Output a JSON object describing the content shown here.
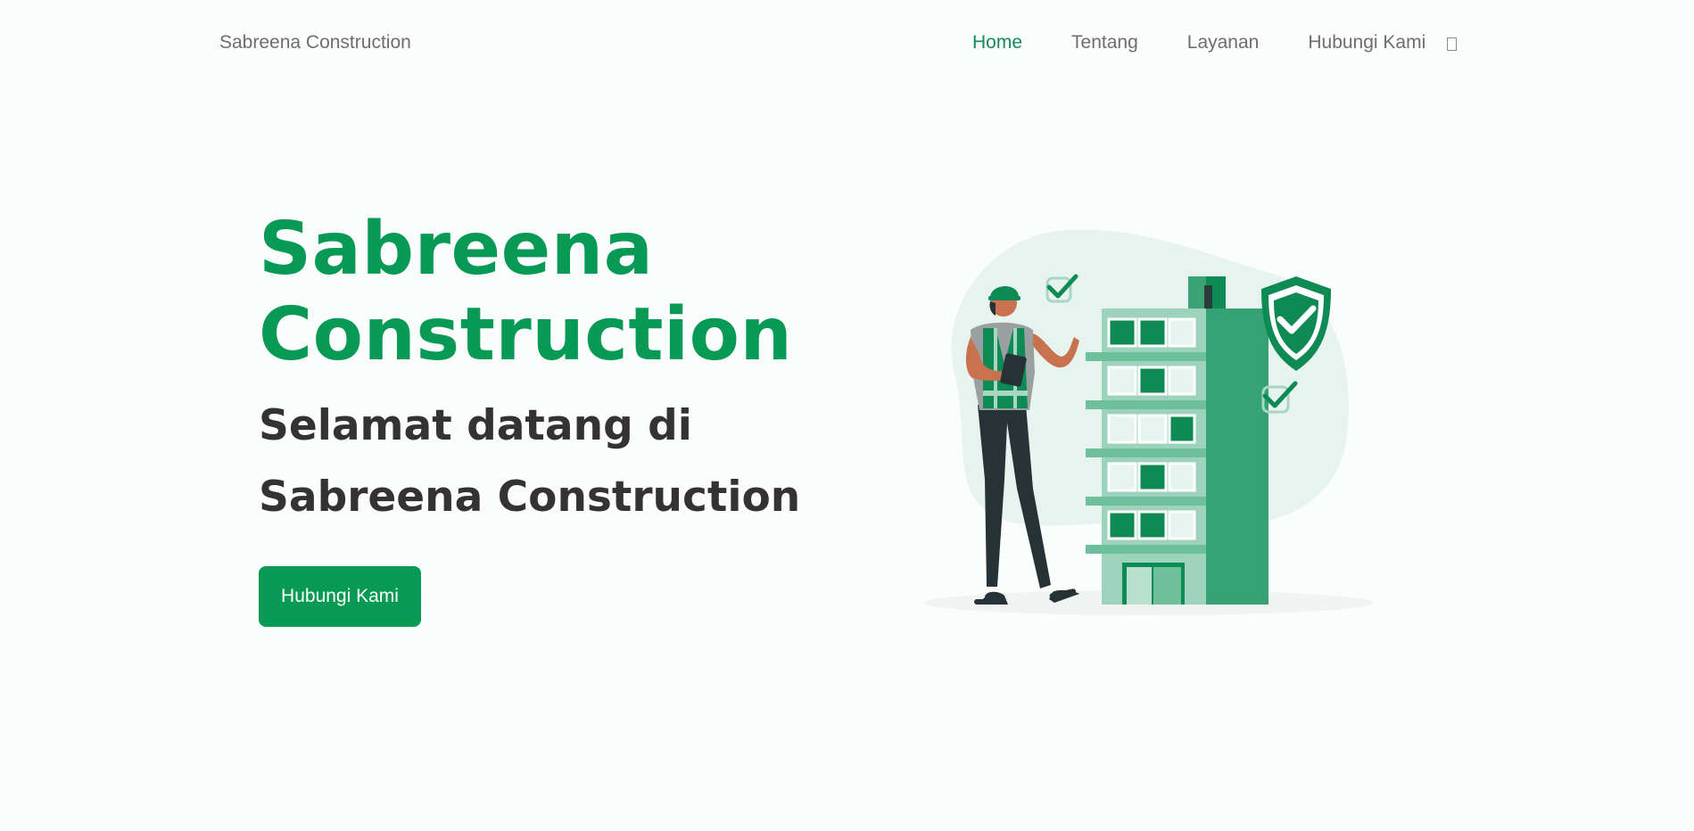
{
  "navbar": {
    "brand": "Sabreena Construction",
    "links": [
      "Home",
      "Tentang",
      "Layanan",
      "Hubungi Kami"
    ],
    "active_link": "Home",
    "theme_toggle_icon": "moon-icon"
  },
  "hero": {
    "title_line1": "Sabreena",
    "title_line2": "Construction",
    "subtitle_line1": "Selamat datang di",
    "subtitle_line2": "Sabreena Construction",
    "cta_label": "Hubungi Kami"
  },
  "colors": {
    "brand_green": "#079a55",
    "text_dark": "#333333",
    "nav_gray": "#6d6d6d",
    "background": "#fbfdfc"
  }
}
